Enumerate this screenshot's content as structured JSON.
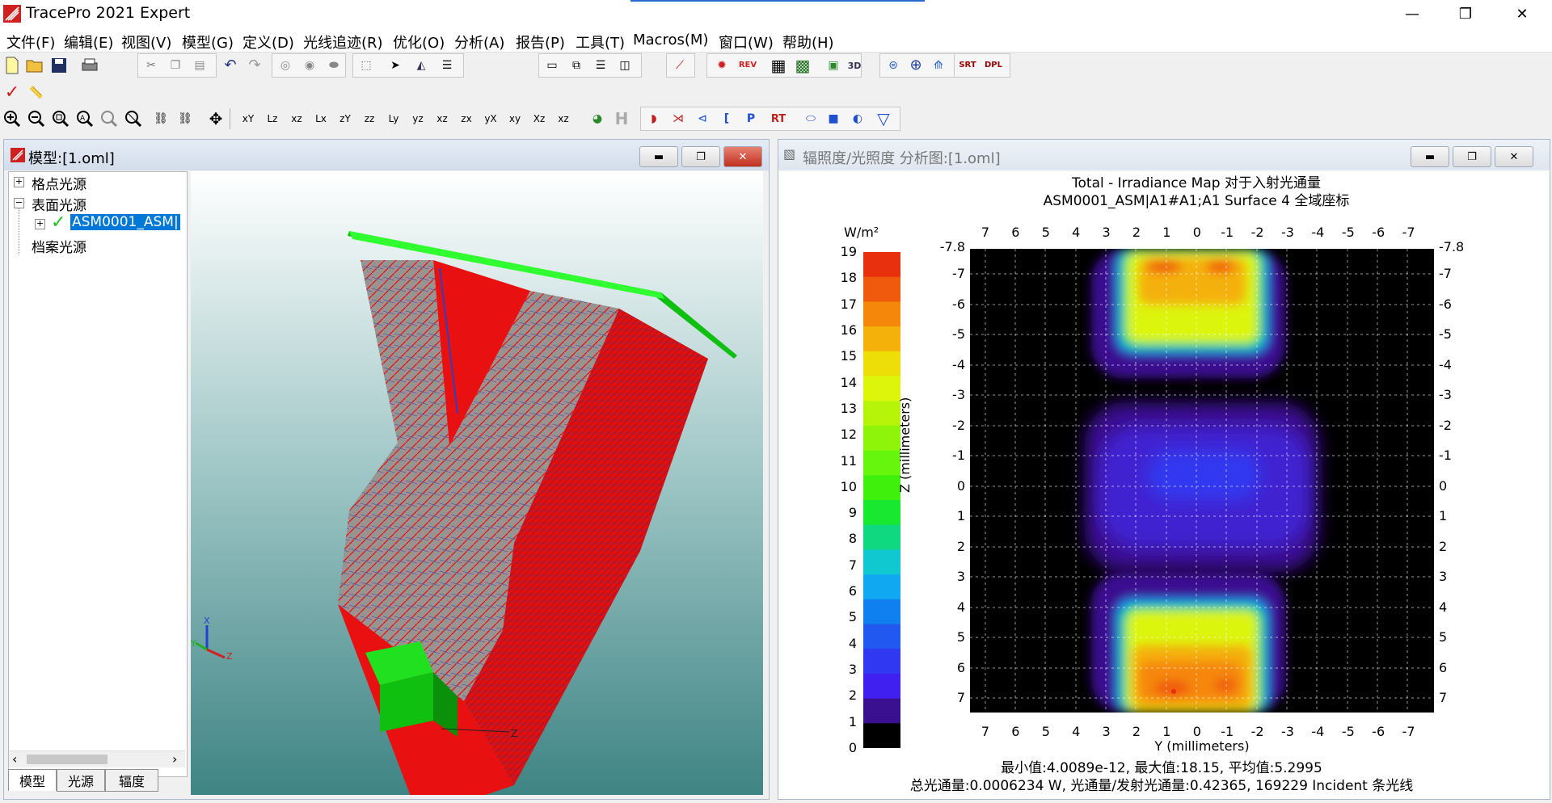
{
  "window": {
    "title": "TracePro 2021 Expert",
    "controls": [
      "—",
      "❐",
      "✕"
    ]
  },
  "menu": [
    "文件(F)",
    "编辑(E)",
    "视图(V)",
    "模型(G)",
    "定义(D)",
    "光线追迹(R)",
    "优化(O)",
    "分析(A)",
    "报告(P)",
    "工具(T)",
    "Macros(M)",
    "窗口(W)",
    "帮助(H)"
  ],
  "toolbar": {
    "srt_label": "SRT",
    "dpl_label": "DPL",
    "rev_label": "REV",
    "d3_label": "3D",
    "p_label": "P",
    "rt_label": "RT",
    "h_label": "H",
    "axis_labels": [
      "xY",
      "Lz",
      "xz",
      "Lx",
      "zY",
      "zz",
      "Ly",
      "yz",
      "xz",
      "zx",
      "yX",
      "xy",
      "Xz",
      "xz"
    ]
  },
  "model_window": {
    "title": "模型:[1.oml]",
    "tree": [
      {
        "label": "格点光源",
        "expander": "+"
      },
      {
        "label": "表面光源",
        "expander": "−"
      },
      {
        "label": "ASM0001_ASM|",
        "expander": "+",
        "selected": true
      },
      {
        "label": "档案光源",
        "expander": ""
      }
    ],
    "tabs": [
      "模型",
      "光源",
      "辐度"
    ],
    "axes": {
      "x": "X",
      "y": "Y",
      "z": "Z"
    }
  },
  "analysis_window": {
    "title": "辐照度/光照度 分析图:[1.oml]",
    "title_line1": "Total - Irradiance Map 对于入射光通量",
    "title_line2": "ASM0001_ASM|A1#A1;A1 Surface 4    全域座标",
    "colorbar_unit": "W/m²",
    "colorbar_ticks": [
      "19",
      "18",
      "17",
      "16",
      "15",
      "14",
      "13",
      "12",
      "11",
      "10",
      "9",
      "8",
      "7",
      "6",
      "5",
      "4",
      "3",
      "2",
      "1",
      "0"
    ],
    "colorbar_colors": [
      "#e8300f",
      "#f05a0c",
      "#f5870a",
      "#f4b10a",
      "#eede08",
      "#dcf50a",
      "#b6f50a",
      "#8ef50a",
      "#66f50c",
      "#3ef00c",
      "#18e830",
      "#10d880",
      "#10c8d0",
      "#10a8f0",
      "#1080f0",
      "#2058f0",
      "#3038f0",
      "#4020f0",
      "#3a1090",
      "#2a0a55",
      "#000000"
    ],
    "z_axis_label": "Z (millimeters)",
    "y_axis_label": "Y (millimeters)",
    "x_ticks": [
      "7",
      "6",
      "5",
      "4",
      "3",
      "2",
      "1",
      "0",
      "-1",
      "-2",
      "-3",
      "-4",
      "-5",
      "-6",
      "-7"
    ],
    "z_ticks": [
      "-7.8",
      "-7",
      "-6",
      "-5",
      "-4",
      "-3",
      "-2",
      "-1",
      "0",
      "1",
      "2",
      "3",
      "4",
      "5",
      "6",
      "7"
    ],
    "stats_line1": "最小值:4.0089e-12, 最大值:18.15, 平均值:5.2995",
    "stats_line2": "总光通量:0.0006234 W, 光通量/发射光通量:0.42365, 169229 Incident 条光线"
  }
}
